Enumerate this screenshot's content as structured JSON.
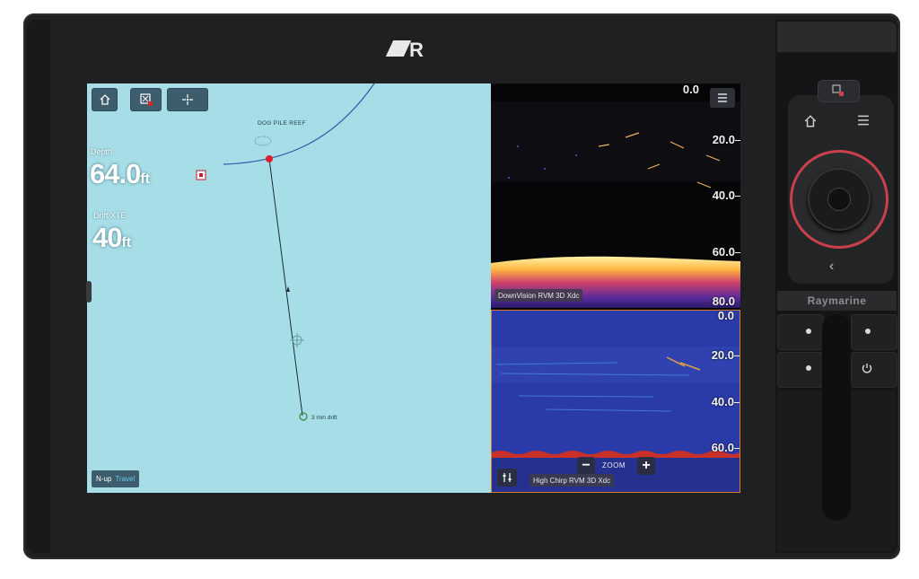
{
  "brand": {
    "logo_text": "R",
    "device_label": "Raymarine"
  },
  "chart": {
    "depth_label": "Depth",
    "depth_value": "64.0",
    "depth_unit": "ft",
    "drift_label": "Drift XTE",
    "drift_value": "40",
    "drift_unit": "ft",
    "reef_label": "DOG PILE REEF",
    "drift_marker_label": "3 min drift",
    "orientation": "N-up",
    "orientation_mode": "Travel",
    "buttons": [
      "home-icon",
      "waypoint-icon",
      "gps-icon"
    ],
    "water_color": "#a6dde7"
  },
  "sonar_top": {
    "source": "DownVision RVM 3D Xdc",
    "depths": [
      "0.0",
      "20.0",
      "40.0",
      "60.0",
      "80.0"
    ]
  },
  "sonar_bottom": {
    "source": "High Chirp RVM 3D Xdc",
    "depths": [
      "0.0",
      "20.0",
      "40.0",
      "60.0"
    ],
    "zoom_label": "ZOOM",
    "zoom_minus": "−",
    "zoom_plus": "+",
    "active_border_color": "#d97a2e"
  },
  "panel": {
    "back_glyph": "‹"
  }
}
